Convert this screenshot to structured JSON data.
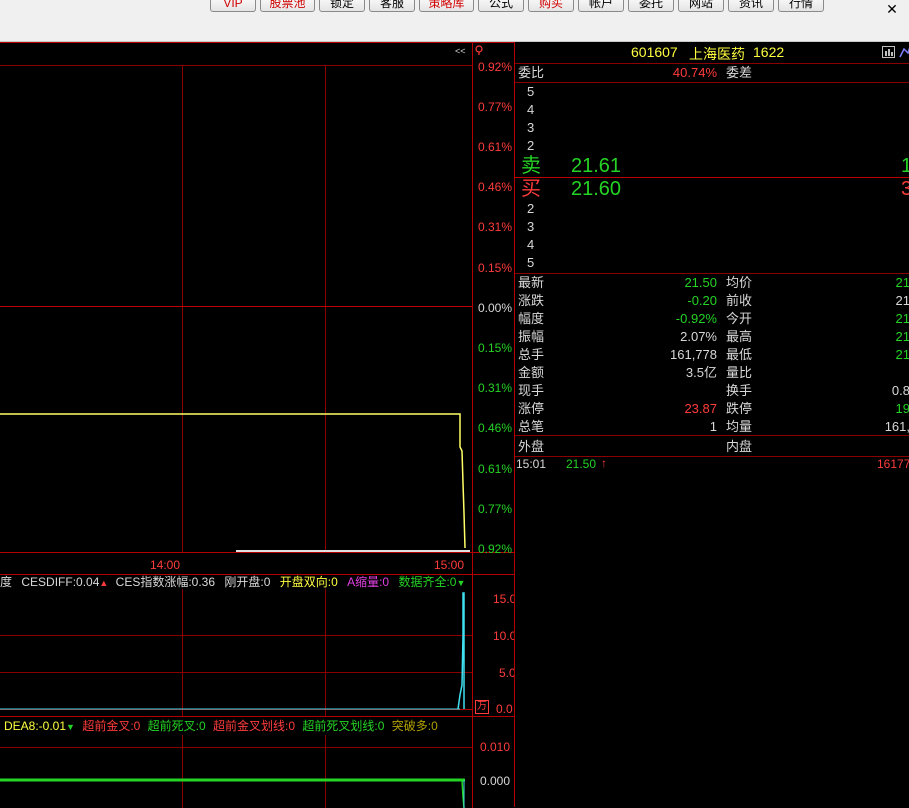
{
  "toolbar": {
    "buttons": [
      {
        "label": "VIP",
        "color": "red"
      },
      {
        "label": "股票池",
        "color": "red"
      },
      {
        "label": "锁定",
        "color": "black"
      },
      {
        "label": "客服",
        "color": "black"
      },
      {
        "label": "策略库",
        "color": "red"
      },
      {
        "label": "公式",
        "color": "black"
      },
      {
        "label": "购买",
        "color": "red"
      },
      {
        "label": "帐户",
        "color": "black"
      },
      {
        "label": "委托",
        "color": "black"
      },
      {
        "label": "网站",
        "color": "black"
      },
      {
        "label": "资讯",
        "color": "black"
      },
      {
        "label": "行情",
        "color": "black"
      }
    ],
    "close_label": "✕"
  },
  "chart": {
    "collapse_label": "<<",
    "pct_labels_upper": [
      "0.92%",
      "0.77%",
      "0.61%",
      "0.46%",
      "0.31%",
      "0.15%",
      "0.00%"
    ],
    "pct_labels_lower": [
      "0.15%",
      "0.31%",
      "0.46%",
      "0.61%",
      "0.77%",
      "0.92%"
    ],
    "time_labels": [
      "14:00",
      "15:00"
    ],
    "colors": {
      "up": "#ff3c3c",
      "down": "#25d325",
      "line": "#ffff66",
      "grid": "#8a0000"
    }
  },
  "indicator1": {
    "items": [
      {
        "text": "度",
        "color": "#d8d8d8"
      },
      {
        "text": "CESDIFF:0.04",
        "color": "#d8d8d8"
      },
      {
        "text": "▲",
        "color": "#ff3c3c"
      },
      {
        "text": "CES指数涨幅:0.36",
        "color": "#d8d8d8"
      },
      {
        "text": "刚开盘:0",
        "color": "#d8d8d8"
      },
      {
        "text": "开盘双向:0",
        "color": "#ffff40"
      },
      {
        "text": "A缩量:0",
        "color": "#e040e0"
      },
      {
        "text": "数据齐全:0",
        "color": "#25d325"
      },
      {
        "text": "▼",
        "color": "#25d325"
      }
    ],
    "axis": [
      "15.0",
      "10.0",
      "5.0",
      "0.0"
    ],
    "corner_glyph": "万"
  },
  "indicator2": {
    "items": [
      {
        "text": "DEA8:-0.01",
        "color": "#ffff40"
      },
      {
        "text": "▼",
        "color": "#25d325"
      },
      {
        "text": "超前金叉:0",
        "color": "#ff3c3c"
      },
      {
        "text": "超前死叉:0",
        "color": "#25d325"
      },
      {
        "text": "超前金叉划线:0",
        "color": "#ff3c3c"
      },
      {
        "text": "超前死叉划线:0",
        "color": "#25d325"
      },
      {
        "text": "突破多:0",
        "color": "#b0a000"
      }
    ],
    "axis": [
      "0.010",
      "0.000"
    ]
  },
  "quote": {
    "code": "601607",
    "name": "上海医药",
    "extra": "1622",
    "webi_label": "委比",
    "webi_value": "40.74%",
    "weicha_label": "委差",
    "sell_levels": [
      "5",
      "4",
      "3",
      "2"
    ],
    "sell1_label": "卖",
    "sell1_price": "21.61",
    "sell1_vol": "1",
    "buy1_label": "买",
    "buy1_price": "21.60",
    "buy1_vol": "3",
    "buy_levels": [
      "2",
      "3",
      "4",
      "5"
    ],
    "stats": [
      {
        "l": "最新",
        "v": "21.50",
        "vc": "#25d325",
        "l2": "均价",
        "v2": "21",
        "v2c": "#25d325"
      },
      {
        "l": "涨跌",
        "v": "-0.20",
        "vc": "#25d325",
        "l2": "前收",
        "v2": "21",
        "v2c": "#d8d8d8"
      },
      {
        "l": "幅度",
        "v": "-0.92%",
        "vc": "#25d325",
        "l2": "今开",
        "v2": "21",
        "v2c": "#25d325"
      },
      {
        "l": "振幅",
        "v": "2.07%",
        "vc": "#d8d8d8",
        "l2": "最高",
        "v2": "21",
        "v2c": "#25d325"
      },
      {
        "l": "总手",
        "v": "161,778",
        "vc": "#d8d8d8",
        "l2": "最低",
        "v2": "21",
        "v2c": "#25d325"
      },
      {
        "l": "金额",
        "v": "3.5亿",
        "vc": "#d8d8d8",
        "l2": "量比",
        "v2": "",
        "v2c": "#d8d8d8"
      },
      {
        "l": "现手",
        "v": "",
        "vc": "#d8d8d8",
        "l2": "换手",
        "v2": "0.8",
        "v2c": "#d8d8d8"
      },
      {
        "l": "涨停",
        "v": "23.87",
        "vc": "#ff3c3c",
        "l2": "跌停",
        "v2": "19",
        "v2c": "#25d325"
      },
      {
        "l": "总笔",
        "v": "1",
        "vc": "#d8d8d8",
        "l2": "均量",
        "v2": "161,",
        "v2c": "#d8d8d8"
      }
    ],
    "waipan_label": "外盘",
    "neipan_label": "内盘",
    "tick": {
      "time": "15:01",
      "price": "21.50",
      "arrow": "↑",
      "vol": "16177"
    }
  }
}
